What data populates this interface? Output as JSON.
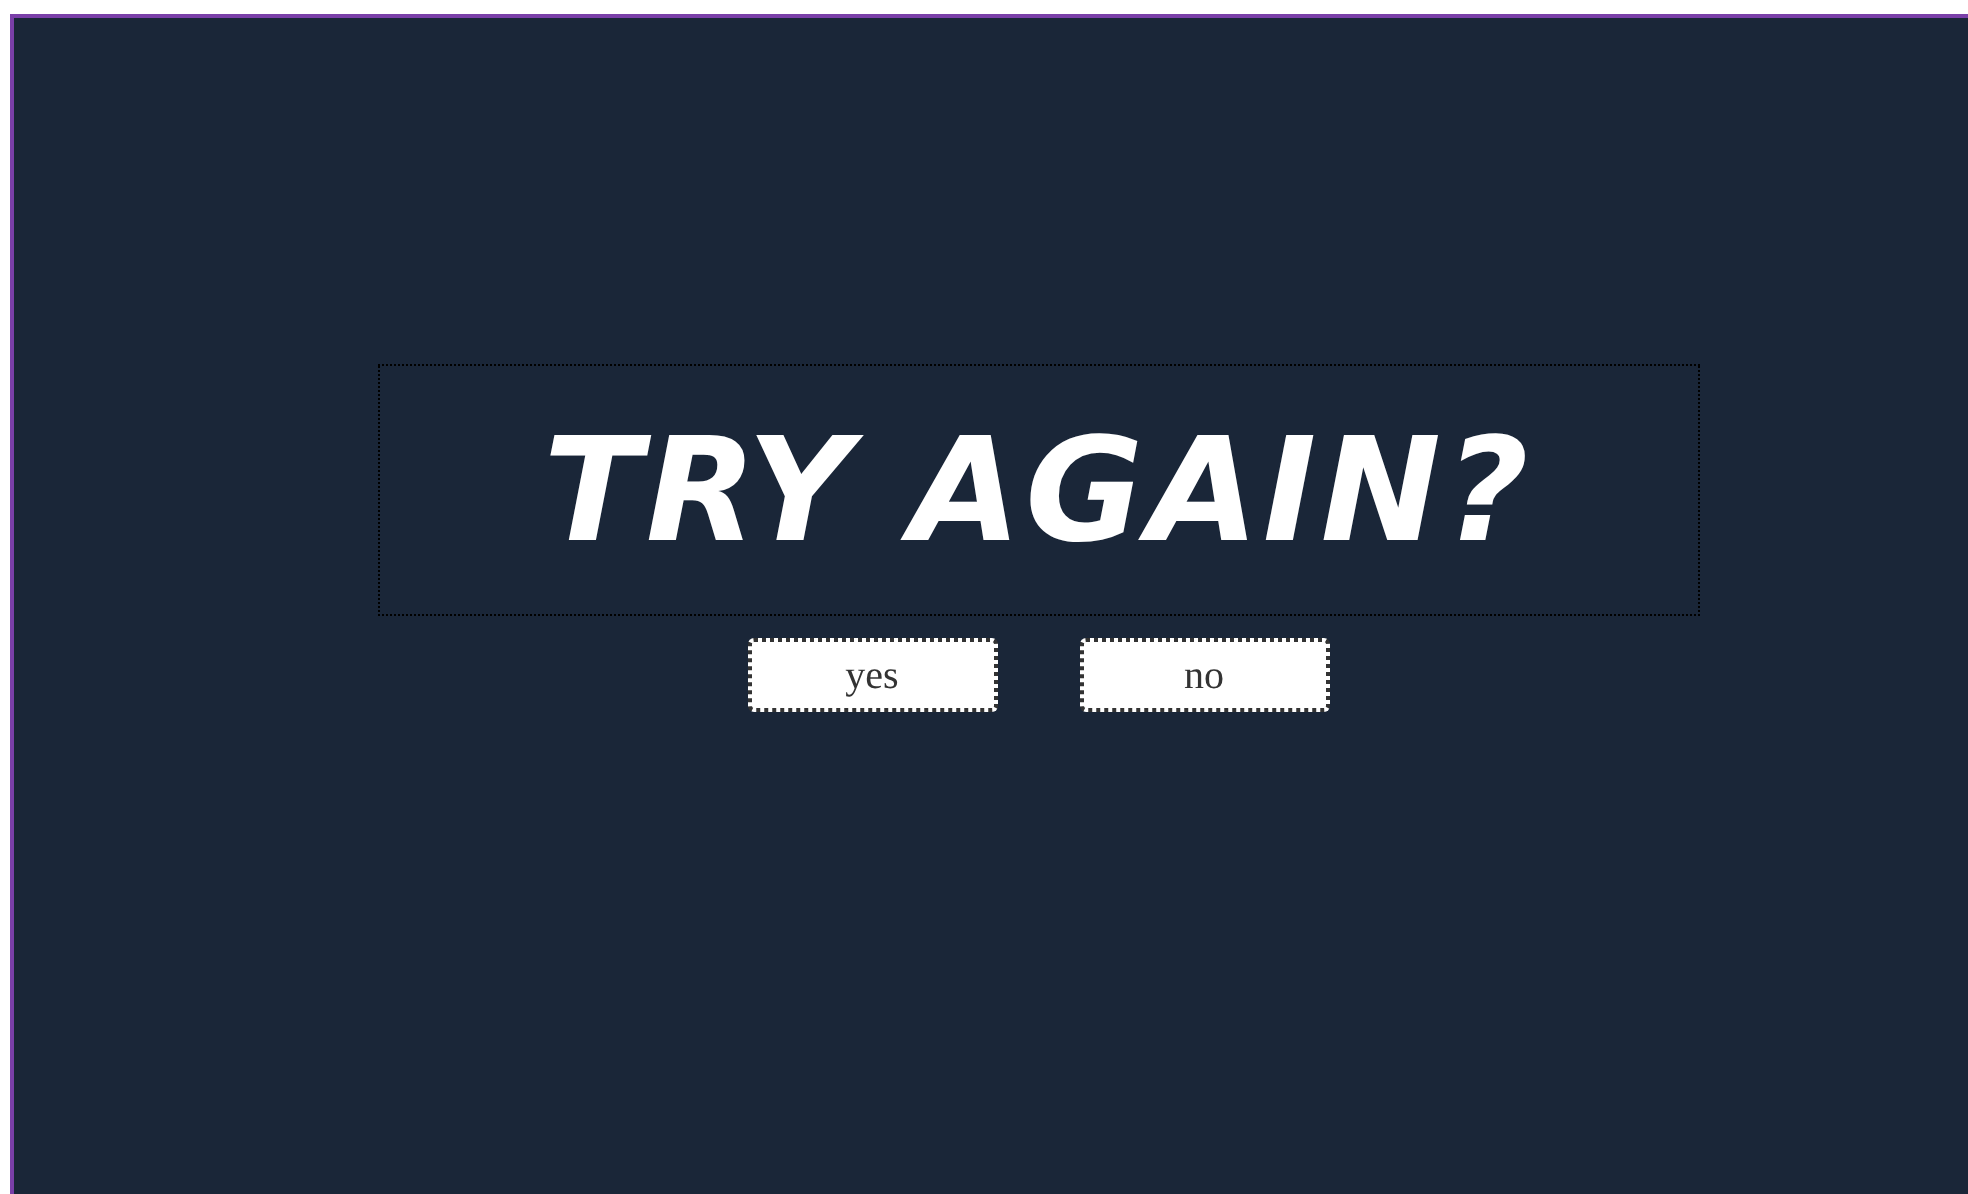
{
  "heading": "TRY AGAIN?",
  "buttons": [
    "yes",
    "no"
  ]
}
